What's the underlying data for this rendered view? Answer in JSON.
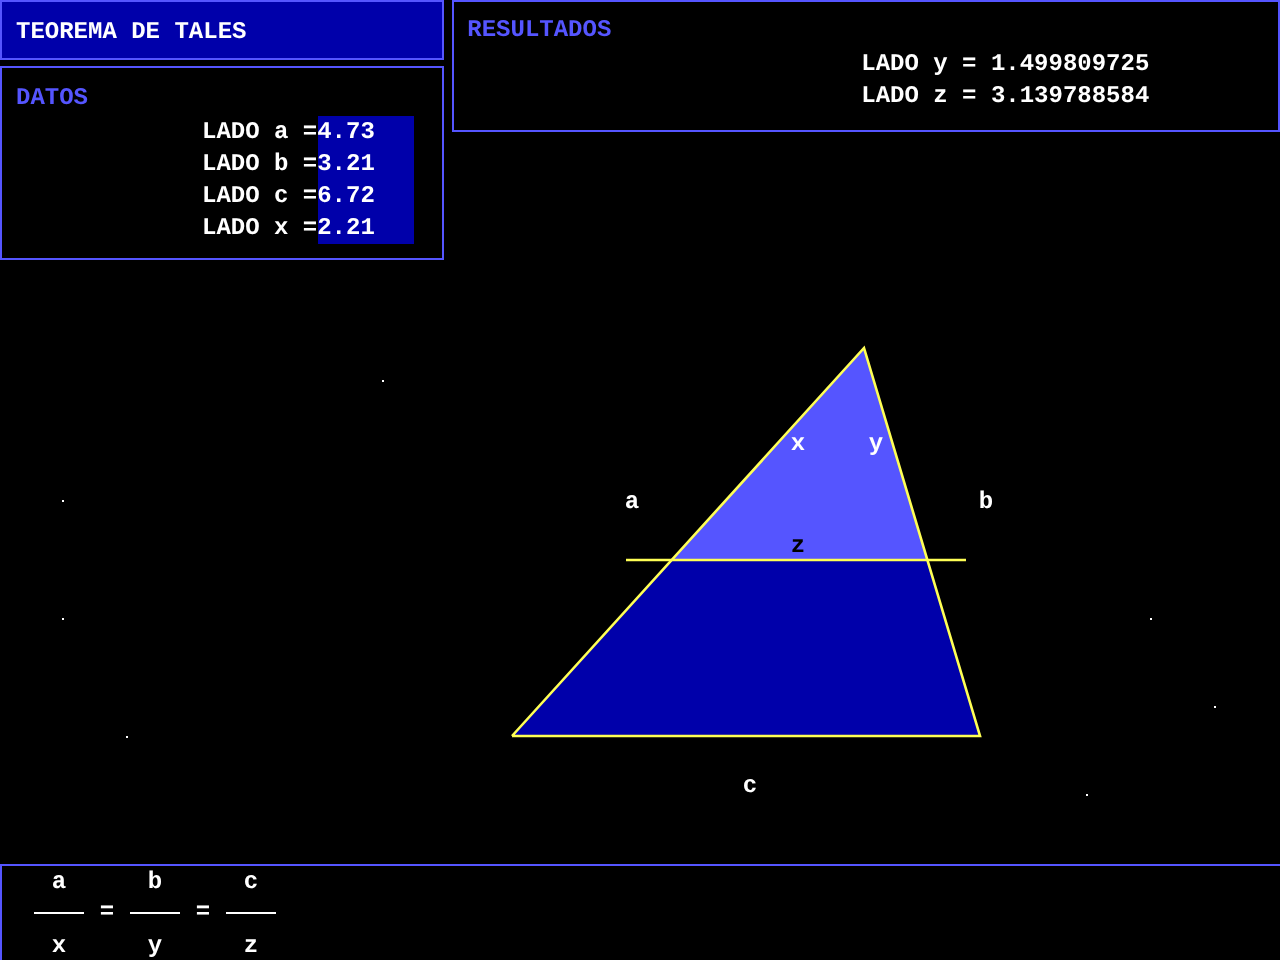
{
  "title": "TEOREMA DE TALES",
  "data": {
    "heading": "DATOS",
    "rows": [
      {
        "label": "LADO a =",
        "value": "4.73"
      },
      {
        "label": "LADO b =",
        "value": "3.21"
      },
      {
        "label": "LADO c =",
        "value": "6.72"
      },
      {
        "label": "LADO x =",
        "value": "2.21"
      }
    ]
  },
  "results": {
    "heading": "RESULTADOS",
    "rows": [
      "LADO y = 1.499809725",
      "LADO z = 3.139788584"
    ]
  },
  "diagram": {
    "labels": [
      {
        "side": "x"
      },
      {
        "side": "y"
      },
      {
        "side": "a"
      },
      {
        "side": "b"
      },
      {
        "side": "z"
      },
      {
        "side": "c"
      }
    ]
  },
  "formula": {
    "fractions": [
      {
        "numerator": "a",
        "denominator": "x"
      },
      {
        "numerator": "b",
        "denominator": "y"
      },
      {
        "numerator": "c",
        "denominator": "z"
      }
    ],
    "equals": [
      "=",
      "="
    ]
  }
}
